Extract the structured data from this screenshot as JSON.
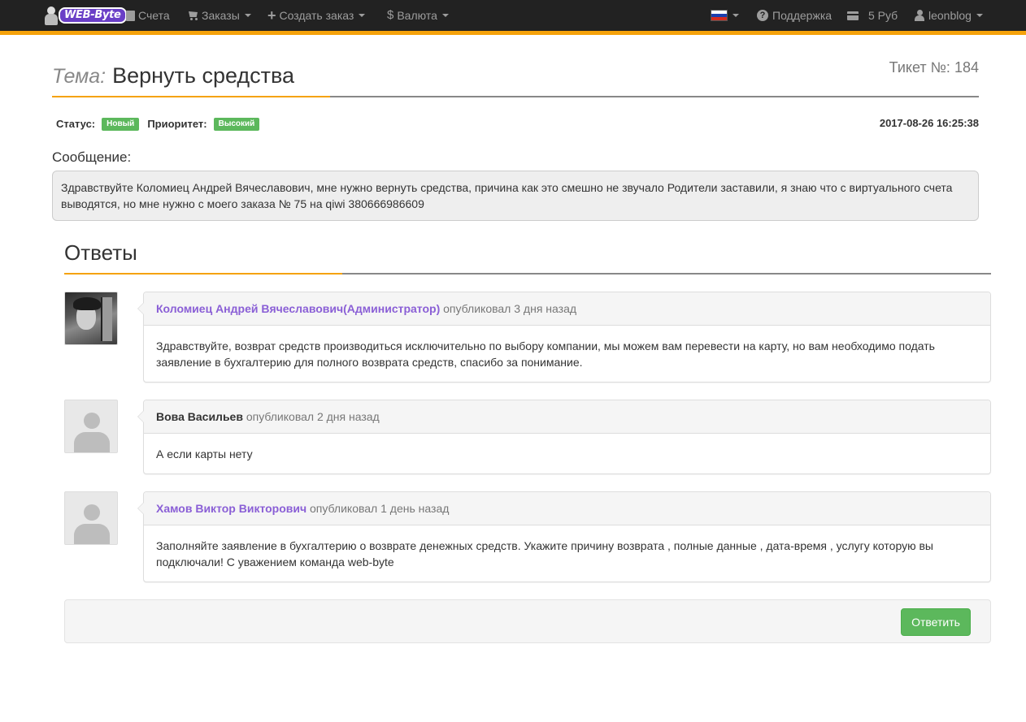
{
  "navbar": {
    "brand": "WEB-Byte",
    "items": [
      {
        "label": "Счета",
        "icon": "document-icon"
      },
      {
        "label": "Заказы",
        "icon": "cart-icon"
      },
      {
        "label": "Создать заказ",
        "icon": "plus-icon"
      },
      {
        "label": "Валюта",
        "icon": "dollar-icon"
      }
    ],
    "language_flag": "russia-flag-icon",
    "support": "Поддержка",
    "balance": "5 Руб",
    "user": "leonblog",
    "accent_color": "#f5a20a"
  },
  "ticket": {
    "subject_label": "Тема:",
    "subject": "Вернуть средства",
    "number_label": "Тикет №:",
    "number": "184",
    "status_label": "Статус:",
    "status": "Новый",
    "priority_label": "Приоритет:",
    "priority": "Высокий",
    "date": "2017-08-26 16:25:38",
    "message_label": "Сообщение:",
    "message": "Здравствуйте Коломиец Андрей Вячеславович, мне нужно вернуть средства, причина как это смешно не звучало Родители заставили, я знаю что с виртуального счета выводятся, но мне нужно с моего заказа № 75 на qiwi 380666986609"
  },
  "answers": {
    "title": "Ответы",
    "items": [
      {
        "author": "Коломиец Андрей Вячеславович(Администратор)",
        "posted": "опубликовал 3 дня назад",
        "text": "Здравствуйте, возврат средств производиться исключительно по выбору компании, мы можем вам перевести на карту, но вам необходимо подать заявление в бухгалтерию для полного возврата средств, спасибо за понимание."
      },
      {
        "author": "Вова Васильев",
        "posted": "опубликовал 2 дня назад",
        "text": "А если карты нету"
      },
      {
        "author": "Хамов Виктор Викторович",
        "posted": "опубликовал 1 день назад",
        "text": "Заполняйте заявление в бухгалтерию о возврате денежных средств. Укажите причину возврата , полные данные , дата-время , услугу которую вы подключали! С уважением команда web-byte"
      }
    ],
    "reply_button": "Ответить"
  }
}
